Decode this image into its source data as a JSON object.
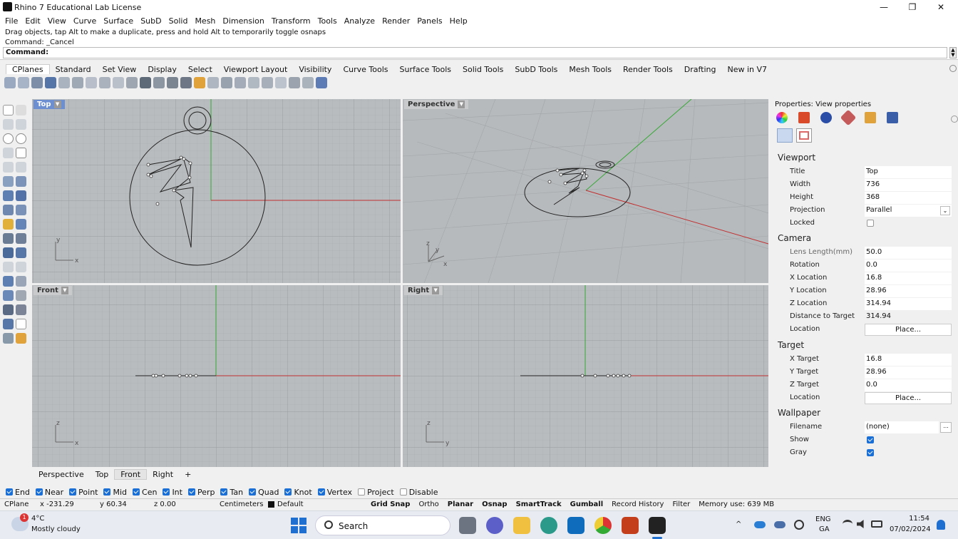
{
  "window": {
    "title": "Rhino 7 Educational Lab License",
    "min": "—",
    "max": "❐",
    "close": "✕"
  },
  "menu": [
    "File",
    "Edit",
    "View",
    "Curve",
    "Surface",
    "SubD",
    "Solid",
    "Mesh",
    "Dimension",
    "Transform",
    "Tools",
    "Analyze",
    "Render",
    "Panels",
    "Help"
  ],
  "command": {
    "history1": "Drag objects, tap Alt to make a duplicate, press and hold Alt to temporarily toggle osnaps",
    "history2": "Command: _Cancel",
    "prompt": "Command:"
  },
  "tabs": [
    "CPlanes",
    "Standard",
    "Set View",
    "Display",
    "Select",
    "Viewport Layout",
    "Visibility",
    "Curve Tools",
    "Surface Tools",
    "Solid Tools",
    "SubD Tools",
    "Mesh Tools",
    "Render Tools",
    "Drafting",
    "New in V7"
  ],
  "viewports": {
    "top": {
      "label": "Top"
    },
    "perspective": {
      "label": "Perspective"
    },
    "front": {
      "label": "Front"
    },
    "right": {
      "label": "Right"
    }
  },
  "viewport_tabs": [
    "Perspective",
    "Top",
    "Front",
    "Right",
    "+"
  ],
  "osnaps": [
    {
      "label": "End",
      "checked": true
    },
    {
      "label": "Near",
      "checked": true
    },
    {
      "label": "Point",
      "checked": true
    },
    {
      "label": "Mid",
      "checked": true
    },
    {
      "label": "Cen",
      "checked": true
    },
    {
      "label": "Int",
      "checked": true
    },
    {
      "label": "Perp",
      "checked": true
    },
    {
      "label": "Tan",
      "checked": true
    },
    {
      "label": "Quad",
      "checked": true
    },
    {
      "label": "Knot",
      "checked": true
    },
    {
      "label": "Vertex",
      "checked": true
    },
    {
      "label": "Project",
      "checked": false
    },
    {
      "label": "Disable",
      "checked": false
    }
  ],
  "status": {
    "cplane": "CPlane",
    "x": "x -231.29",
    "y": "y 60.34",
    "z": "z 0.00",
    "units": "Centimeters",
    "layer": "Default",
    "grid_snap": "Grid Snap",
    "ortho": "Ortho",
    "planar": "Planar",
    "osnap": "Osnap",
    "smarttrack": "SmartTrack",
    "gumball": "Gumball",
    "record_history": "Record History",
    "filter": "Filter",
    "memory": "Memory use: 639 MB"
  },
  "properties": {
    "header": "Properties: View properties",
    "sections": {
      "viewport": "Viewport",
      "camera": "Camera",
      "target": "Target",
      "wallpaper": "Wallpaper"
    },
    "viewport_rows": [
      {
        "label": "Title",
        "value": "Top"
      },
      {
        "label": "Width",
        "value": "736"
      },
      {
        "label": "Height",
        "value": "368"
      },
      {
        "label": "Projection",
        "value": "Parallel"
      },
      {
        "label": "Locked",
        "value": ""
      }
    ],
    "camera_rows": [
      {
        "label": "Lens Length(mm)",
        "value": "50.0"
      },
      {
        "label": "Rotation",
        "value": "0.0"
      },
      {
        "label": "X Location",
        "value": "16.8"
      },
      {
        "label": "Y Location",
        "value": "28.96"
      },
      {
        "label": "Z Location",
        "value": "314.94"
      },
      {
        "label": "Distance to Target",
        "value": "314.94"
      },
      {
        "label": "Location",
        "value": "Place..."
      }
    ],
    "target_rows": [
      {
        "label": "X Target",
        "value": "16.8"
      },
      {
        "label": "Y Target",
        "value": "28.96"
      },
      {
        "label": "Z Target",
        "value": "0.0"
      },
      {
        "label": "Location",
        "value": "Place..."
      }
    ],
    "wallpaper_rows": [
      {
        "label": "Filename",
        "value": "(none)"
      },
      {
        "label": "Show",
        "value": ""
      },
      {
        "label": "Gray",
        "value": ""
      }
    ]
  },
  "taskbar": {
    "weather_temp": "4°C",
    "weather_desc": "Mostly cloudy",
    "search": "Search",
    "lang1": "ENG",
    "lang2": "GA",
    "time": "11:54",
    "date": "07/02/2024",
    "weather_badge": "1"
  }
}
